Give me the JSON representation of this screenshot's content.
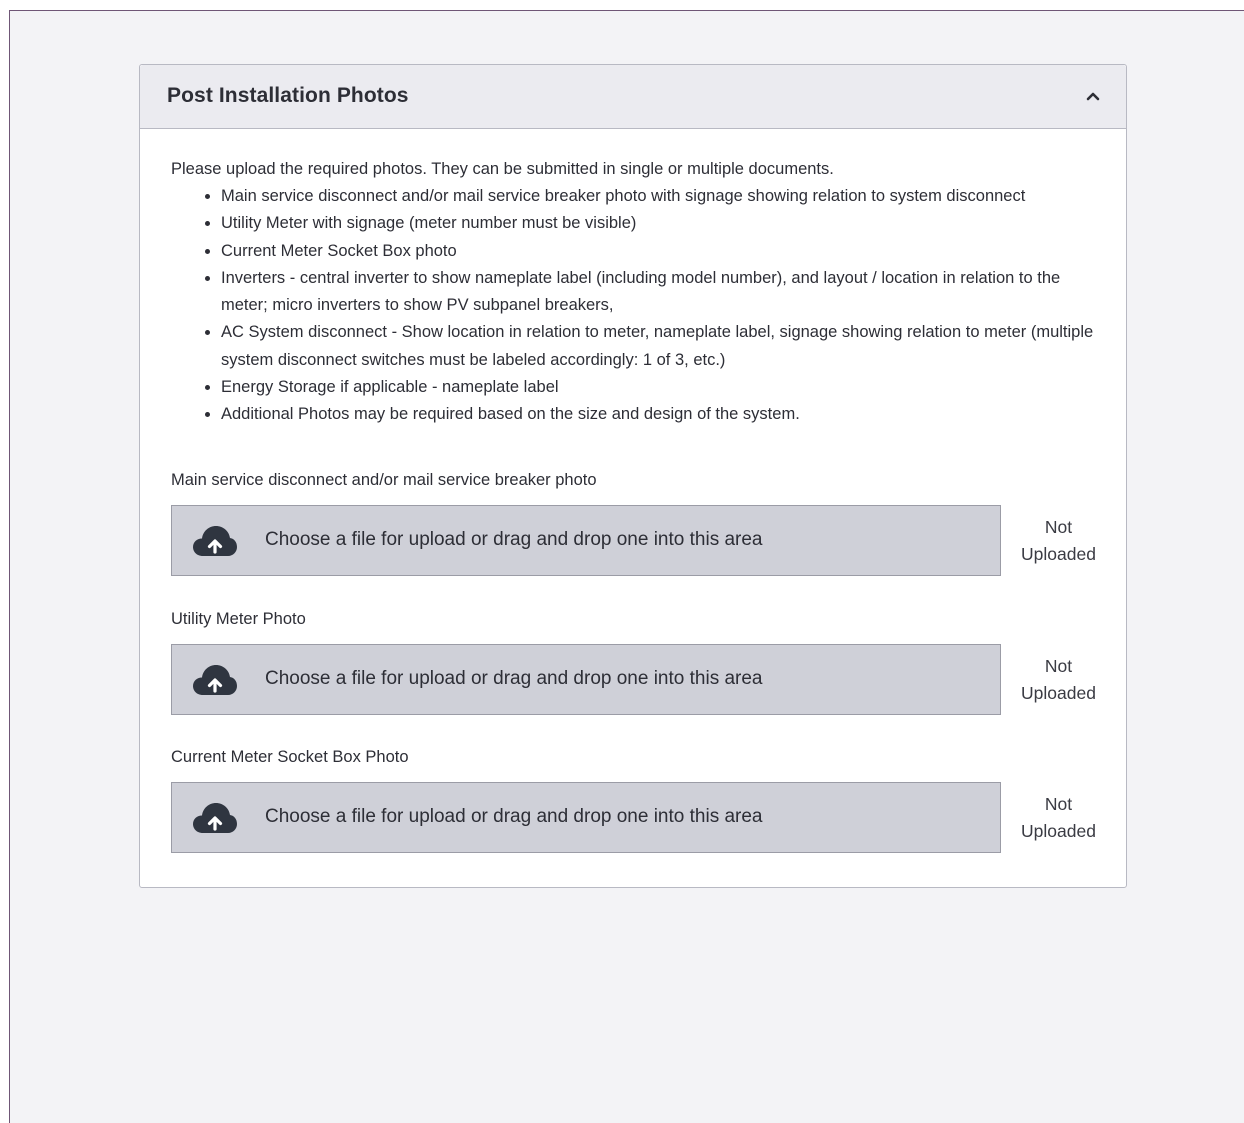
{
  "panel": {
    "title": "Post Installation Photos",
    "toggle_icon": "chevron-up-icon",
    "intro": "Please upload the required photos. They can be submitted in single or multiple documents.",
    "requirements": [
      "Main service disconnect and/or mail service breaker photo with signage showing relation to system disconnect",
      "Utility Meter with signage (meter number must be visible)",
      "Current Meter Socket Box photo",
      "Inverters - central inverter to show nameplate label (including model number), and layout / location in relation to the meter; micro inverters to show PV subpanel breakers,",
      "AC System disconnect - Show location in relation to meter, nameplate label, signage showing relation to meter (multiple system disconnect switches must be labeled accordingly: 1 of 3, etc.)",
      "Energy Storage if applicable - nameplate label",
      "Additional Photos may be required based on the size and design of the system."
    ]
  },
  "uploads": [
    {
      "label": "Main service disconnect and/or mail service breaker photo",
      "dropzone_text": "Choose a file for upload or drag and drop one into this area",
      "status_line1": "Not",
      "status_line2": "Uploaded",
      "icon": "cloud-upload-icon"
    },
    {
      "label": "Utility Meter Photo",
      "dropzone_text": "Choose a file for upload or drag and drop one into this area",
      "status_line1": "Not",
      "status_line2": "Uploaded",
      "icon": "cloud-upload-icon"
    },
    {
      "label": "Current Meter Socket Box Photo",
      "dropzone_text": "Choose a file for upload or drag and drop one into this area",
      "status_line1": "Not",
      "status_line2": "Uploaded",
      "icon": "cloud-upload-icon"
    }
  ],
  "colors": {
    "page_background": "#f3f3f6",
    "panel_header": "#ebebf0",
    "dropzone": "#cfd0d8",
    "icon": "#2f3540"
  }
}
